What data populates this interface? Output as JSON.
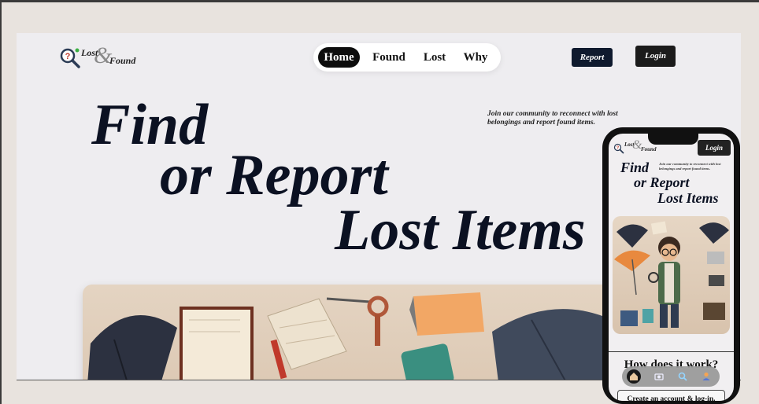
{
  "brand": {
    "lost": "Lost",
    "amp": "&",
    "found": "Found"
  },
  "nav": {
    "items": [
      {
        "label": "Home"
      },
      {
        "label": "Found"
      },
      {
        "label": "Lost"
      },
      {
        "label": "Why"
      }
    ]
  },
  "header": {
    "report_label": "Report",
    "login_label": "Login"
  },
  "hero": {
    "line1": "Find",
    "line2": "or Report",
    "line3": "Lost Items",
    "tagline": "Join our community to reconnect with lost belongings and report found items."
  },
  "mobile": {
    "login_label": "Login",
    "tagline": "Join our community to reconnect with lost belongings and report found items.",
    "hero": {
      "line1": "Find",
      "line2": "or Report",
      "line3": "Lost Items"
    },
    "how_title": "How does it work?",
    "cta_label": "Create an account & log-in.",
    "dock": [
      "home-icon",
      "camera-icon",
      "search-icon",
      "profile-icon"
    ]
  },
  "colors": {
    "accent_dark": "#0b1122",
    "report_button": "#0f1a2e",
    "background": "#eeedf0"
  }
}
